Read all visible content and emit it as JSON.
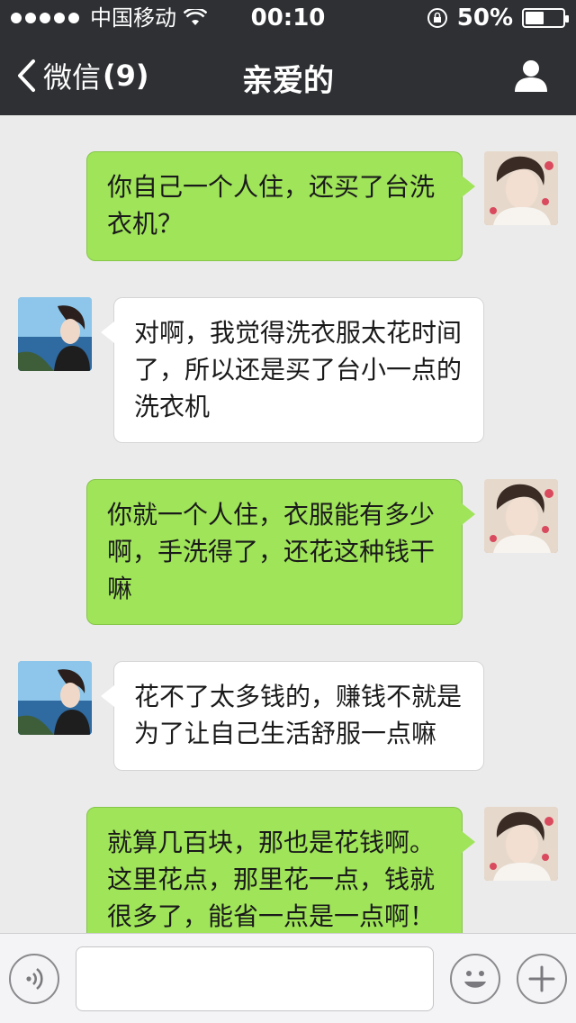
{
  "status_bar": {
    "carrier": "中国移动",
    "time": "00:10",
    "battery_percent": "50%",
    "battery_level": 0.5
  },
  "nav": {
    "back_label": "微信",
    "back_count": "(9)",
    "title": "亲爱的"
  },
  "messages": [
    {
      "side": "me",
      "text": "你自己一个人住，还买了台洗衣机？"
    },
    {
      "side": "them",
      "text": "对啊，我觉得洗衣服太花时间了，所以还是买了台小一点的洗衣机"
    },
    {
      "side": "me",
      "text": "你就一个人住，衣服能有多少啊，手洗得了，还花这种钱干嘛"
    },
    {
      "side": "them",
      "text": "花不了太多钱的，赚钱不就是为了让自己生活舒服一点嘛"
    },
    {
      "side": "me",
      "text": "就算几百块，那也是花钱啊。这里花点，那里花一点，钱就很多了，能省一点是一点啊！"
    }
  ],
  "input": {
    "value": "",
    "placeholder": ""
  },
  "icons": {
    "back": "chevron-left-icon",
    "contact": "person-icon",
    "voice": "voice-icon",
    "emoji": "emoji-icon",
    "plus": "plus-icon"
  },
  "colors": {
    "nav_bg": "#2e3033",
    "chat_bg": "#ebebeb",
    "my_bubble": "#9fe459",
    "their_bubble": "#ffffff"
  }
}
